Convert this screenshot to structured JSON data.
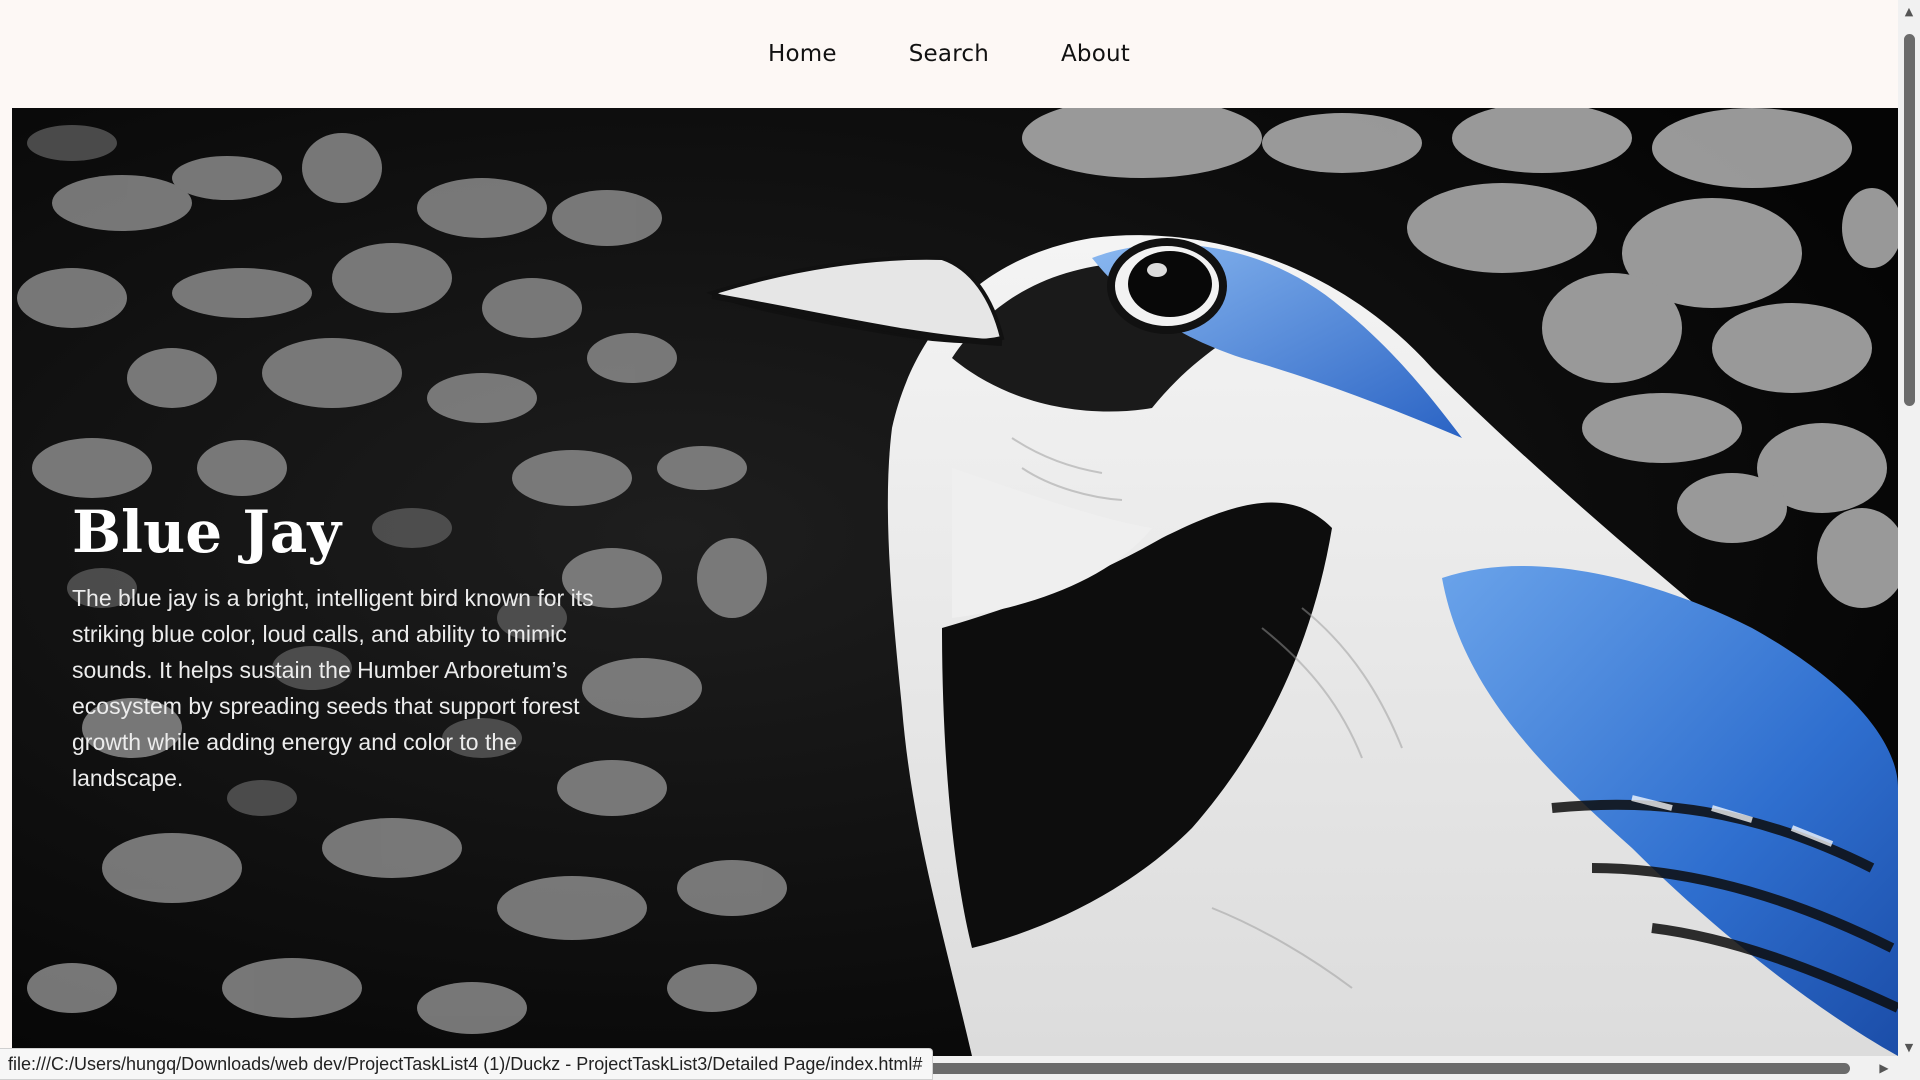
{
  "nav": {
    "items": [
      {
        "label": "Home"
      },
      {
        "label": "Search"
      },
      {
        "label": "About"
      }
    ]
  },
  "hero": {
    "title": "Blue Jay",
    "description": "The blue jay is a bright, intelligent bird known for its striking blue color, loud calls, and ability to mimic sounds. It helps sustain the Humber Arboretum’s ecosystem by spreading seeds that support forest growth while adding energy and color to the landscape."
  },
  "status": {
    "url": "file:///C:/Users/hungq/Downloads/web dev/ProjectTaskList4 (1)/Duckz - ProjectTaskList3/Detailed Page/index.html#"
  },
  "colors": {
    "page_background": "#fdf8f5",
    "hero_background": "#0b0b0b",
    "blue_jay_blue": "#3f7fd6"
  },
  "icons": {
    "scroll_up": "triangle-up-icon",
    "scroll_down": "triangle-down-icon",
    "scroll_right": "triangle-right-icon"
  }
}
